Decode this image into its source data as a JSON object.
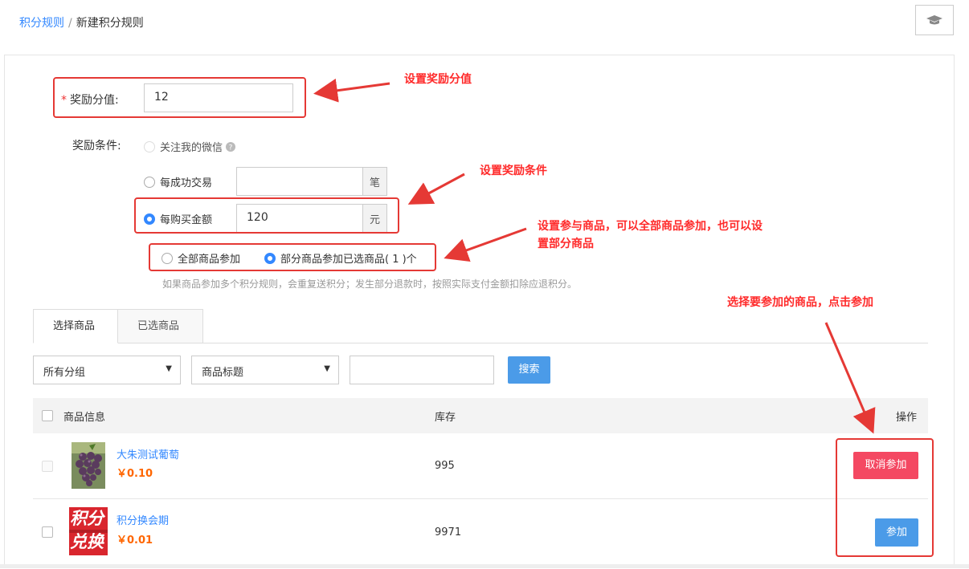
{
  "breadcrumb": {
    "parent": "积分规则",
    "separator": "/",
    "current": "新建积分规则"
  },
  "form": {
    "reward_points_label": "奖励分值:",
    "reward_points_value": "12",
    "condition_label": "奖励条件:",
    "option_follow": "关注我的微信",
    "option_trade": "每成功交易",
    "trade_unit": "笔",
    "trade_value": "",
    "option_amount": "每购买金额",
    "amount_value": "120",
    "amount_unit": "元",
    "scope_all": "全部商品参加",
    "scope_partial": "部分商品参加已选商品( 1 )个",
    "hint": "如果商品参加多个积分规则，会重复送积分；发生部分退款时，按照实际支付金额扣除应退积分。"
  },
  "annotations": {
    "a1": "设置奖励分值",
    "a2": "设置奖励条件",
    "a3_line1": "设置参与商品，可以全部商品参加，也可以设",
    "a3_line2": "置部分商品",
    "a4": "选择要参加的商品，点击参加"
  },
  "tabs": [
    "选择商品",
    "已选商品"
  ],
  "filters": {
    "group": "所有分组",
    "field": "商品标题",
    "search_value": "",
    "search_button": "搜索"
  },
  "table": {
    "headers": {
      "info": "商品信息",
      "stock": "库存",
      "action": "操作"
    },
    "rows": [
      {
        "name": "大朱测试葡萄",
        "price": "￥0.10",
        "stock": "995",
        "action": "取消参加"
      },
      {
        "name": "积分换会期",
        "price": "￥0.01",
        "stock": "9971",
        "action": "参加",
        "thumb_text_1": "积分",
        "thumb_text_2": "兑换"
      }
    ]
  },
  "colors": {
    "accent": "#3388ff",
    "annotation": "#e53935",
    "cancel": "#f44862",
    "join": "#4b9be8",
    "price": "#ff6600"
  }
}
